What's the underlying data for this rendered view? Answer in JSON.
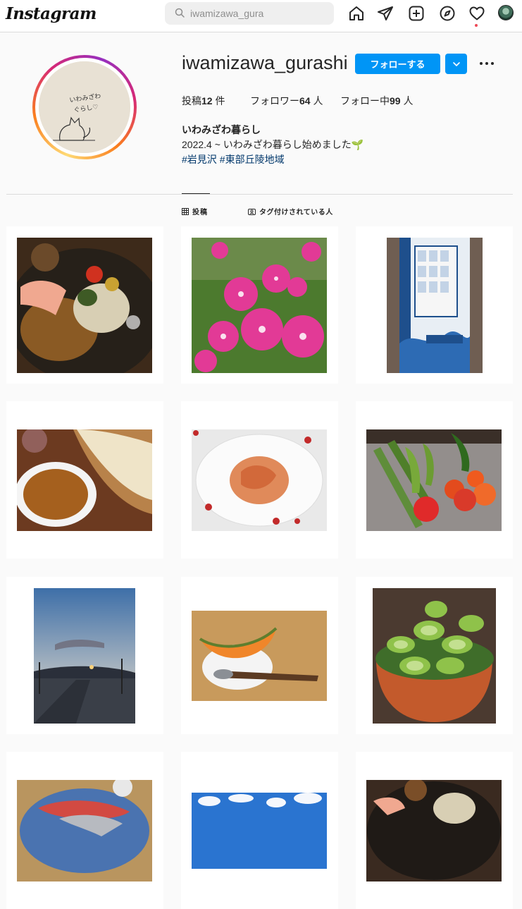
{
  "header": {
    "logo": "Instagram",
    "search_value": "iwamizawa_gura",
    "icons": [
      "home-icon",
      "direct-icon",
      "new-post-icon",
      "explore-icon",
      "activity-heart-icon",
      "profile-avatar"
    ]
  },
  "profile": {
    "username": "iwamizawa_gurashi",
    "follow_label": "フォローする",
    "stats": {
      "posts_label": "投稿",
      "posts_count": "12",
      "posts_unit": "件",
      "followers_label": "フォロワー",
      "followers_count": "64",
      "followers_unit": "人",
      "following_label": "フォロー中",
      "following_count": "99",
      "following_unit": "人"
    },
    "full_name": "いわみざわ暮らし",
    "bio": "2022.4 ~ いわみざわ暮らし始めました🌱",
    "hashtags": [
      "#岩見沢",
      "#東部丘陵地域"
    ],
    "avatar_text_line1": "いわみざわ",
    "avatar_text_line2": "ぐらし♡"
  },
  "tabs": [
    {
      "label": "投稿",
      "icon": "grid-icon",
      "active": true
    },
    {
      "label": "タグ付けされている人",
      "icon": "tagged-icon",
      "active": false
    }
  ],
  "colors": {
    "accent": "#0095f6",
    "link": "#00376b",
    "notification": "#ed4956"
  },
  "posts": [
    {
      "subject": "curry-rice"
    },
    {
      "subject": "pink-petunias"
    },
    {
      "subject": "vending-machine"
    },
    {
      "subject": "curry-naan"
    },
    {
      "subject": "tomato-pasta"
    },
    {
      "subject": "vegetables"
    },
    {
      "subject": "sunset-road"
    },
    {
      "subject": "melon"
    },
    {
      "subject": "cucumber-pickles"
    },
    {
      "subject": "sashimi-platter"
    },
    {
      "subject": "blue-sky"
    },
    {
      "subject": "soup-curry"
    }
  ]
}
